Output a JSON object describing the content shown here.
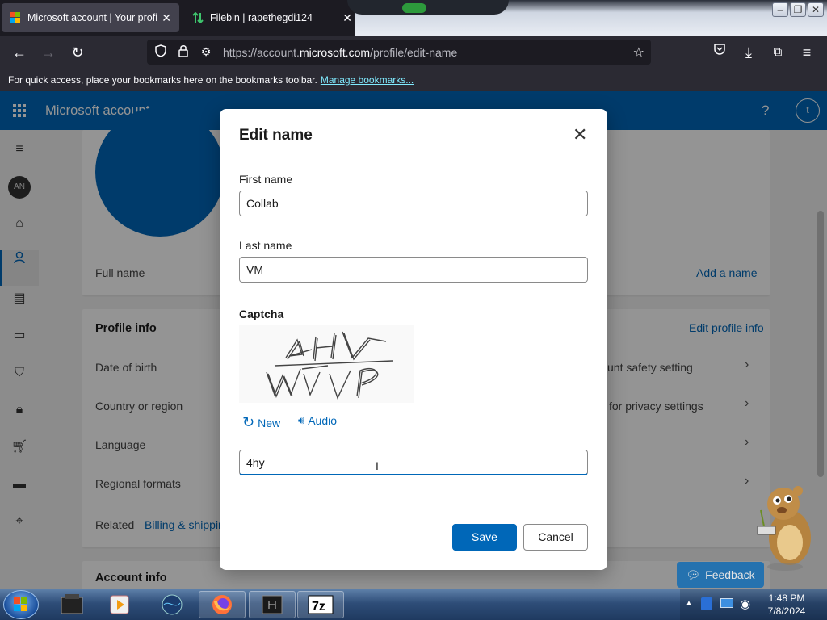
{
  "browser": {
    "tabs": [
      {
        "title": "Microsoft account | Your profile",
        "close": "✕"
      },
      {
        "title": "Filebin | rapethegdi124",
        "close": "✕"
      }
    ],
    "url_prefix": "https://account.",
    "url_domain": "microsoft.com",
    "url_path": "/profile/edit-name",
    "bookmarks_text": "For quick access, place your bookmarks here on the bookmarks toolbar.",
    "bookmarks_link": "Manage bookmarks..."
  },
  "header": {
    "brand": "Microsoft account",
    "help": "?",
    "avatar_initial": "t"
  },
  "sidebar": {
    "avatar_initials": "AN"
  },
  "page": {
    "full_name_label": "Full name",
    "add_name_link": "Add a name",
    "profile_info_title": "Profile info",
    "edit_profile_info": "Edit profile info",
    "rows": [
      "Date of birth",
      "Country or region",
      "Language",
      "Regional formats"
    ],
    "right_rows": [
      "unt safety setting",
      "for privacy settings"
    ],
    "related_label": "Related",
    "billing_link": "Billing & shippin",
    "account_info_title": "Account info"
  },
  "dialog": {
    "title": "Edit name",
    "first_name_label": "First name",
    "first_name_value": "Collab",
    "last_name_label": "Last name",
    "last_name_value": "VM",
    "captcha_label": "Captcha",
    "new_label": "New",
    "audio_label": "Audio",
    "captcha_value": "4hy",
    "save_label": "Save",
    "cancel_label": "Cancel"
  },
  "feedback_label": "Feedback",
  "taskbar": {
    "time": "1:48 PM",
    "date": "7/8/2024"
  },
  "colors": {
    "accent": "#0067b8",
    "browser_chrome": "#2b2a33"
  }
}
